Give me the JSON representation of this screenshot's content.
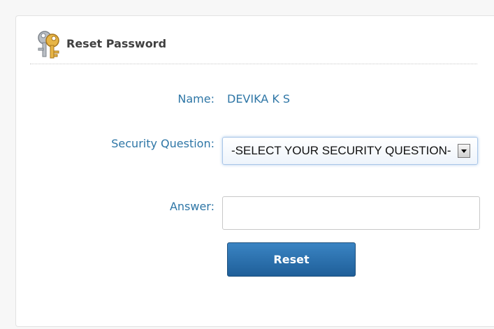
{
  "panel": {
    "title": "Reset Password",
    "icon": "keys-icon"
  },
  "form": {
    "name_label": "Name:",
    "name_value": "DEVIKA K S",
    "security_question_label": "Security Question:",
    "security_question_selected": "-SELECT YOUR SECURITY QUESTION-",
    "answer_label": "Answer:",
    "answer_value": "",
    "reset_label": "Reset"
  },
  "colors": {
    "label": "#2e76a6",
    "title": "#404040",
    "button": "#2a6fad"
  }
}
